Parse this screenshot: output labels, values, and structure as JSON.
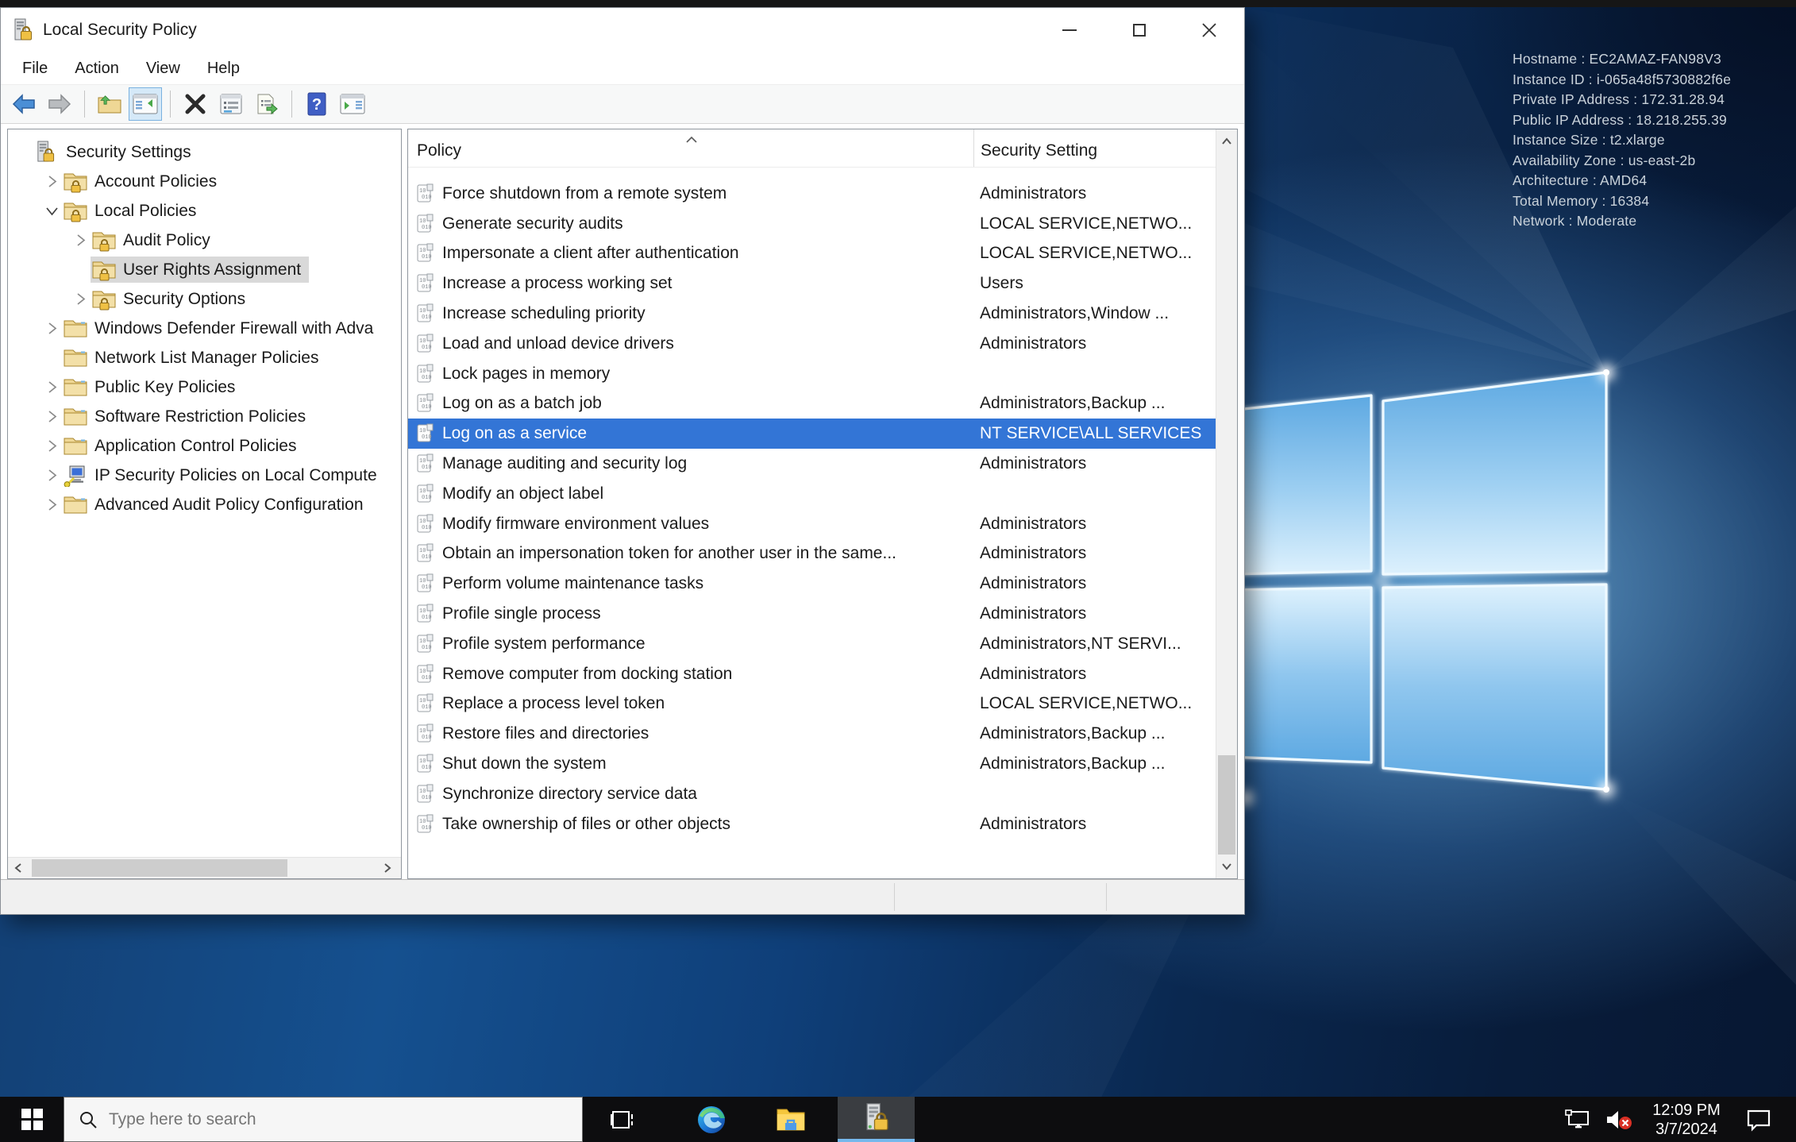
{
  "window": {
    "title": "Local Security Policy",
    "app_icon": "server-lock-icon",
    "menu": [
      "File",
      "Action",
      "View",
      "Help"
    ],
    "controls": [
      "minimize",
      "maximize",
      "close"
    ]
  },
  "toolbar": {
    "buttons": [
      "back",
      "forward",
      "up-one-level",
      "show-console-tree",
      "delete",
      "properties",
      "export-list",
      "help",
      "show-action-pane"
    ],
    "active_button": "show-console-tree"
  },
  "tree": {
    "items": [
      {
        "label": "Security Settings",
        "level": 0,
        "expander": "none",
        "icon": "computer-lock",
        "selected": false
      },
      {
        "label": "Account Policies",
        "level": 1,
        "expander": "collapsed",
        "icon": "folder-lock",
        "selected": false
      },
      {
        "label": "Local Policies",
        "level": 1,
        "expander": "expanded",
        "icon": "folder-lock",
        "selected": false
      },
      {
        "label": "Audit Policy",
        "level": 2,
        "expander": "collapsed",
        "icon": "folder-lock",
        "selected": false
      },
      {
        "label": "User Rights Assignment",
        "level": 2,
        "expander": "none",
        "icon": "folder-lock",
        "selected": true
      },
      {
        "label": "Security Options",
        "level": 2,
        "expander": "collapsed",
        "icon": "folder-lock",
        "selected": false
      },
      {
        "label": "Windows Defender Firewall with Adva",
        "level": 1,
        "expander": "collapsed",
        "icon": "folder",
        "selected": false
      },
      {
        "label": "Network List Manager Policies",
        "level": 1,
        "expander": "none",
        "icon": "folder",
        "selected": false
      },
      {
        "label": "Public Key Policies",
        "level": 1,
        "expander": "collapsed",
        "icon": "folder",
        "selected": false
      },
      {
        "label": "Software Restriction Policies",
        "level": 1,
        "expander": "collapsed",
        "icon": "folder",
        "selected": false
      },
      {
        "label": "Application Control Policies",
        "level": 1,
        "expander": "collapsed",
        "icon": "folder",
        "selected": false
      },
      {
        "label": "IP Security Policies on Local Compute",
        "level": 1,
        "expander": "collapsed",
        "icon": "ipsec",
        "selected": false
      },
      {
        "label": "Advanced Audit Policy Configuration",
        "level": 1,
        "expander": "collapsed",
        "icon": "folder",
        "selected": false
      }
    ]
  },
  "policy_list": {
    "columns": [
      "Policy",
      "Security Setting"
    ],
    "sort": "ascending",
    "rows": [
      {
        "policy": "Force shutdown from a remote system",
        "setting": "Administrators",
        "selected": false
      },
      {
        "policy": "Generate security audits",
        "setting": "LOCAL SERVICE,NETWO...",
        "selected": false
      },
      {
        "policy": "Impersonate a client after authentication",
        "setting": "LOCAL SERVICE,NETWO...",
        "selected": false
      },
      {
        "policy": "Increase a process working set",
        "setting": "Users",
        "selected": false
      },
      {
        "policy": "Increase scheduling priority",
        "setting": "Administrators,Window ...",
        "selected": false
      },
      {
        "policy": "Load and unload device drivers",
        "setting": "Administrators",
        "selected": false
      },
      {
        "policy": "Lock pages in memory",
        "setting": "",
        "selected": false
      },
      {
        "policy": "Log on as a batch job",
        "setting": "Administrators,Backup ...",
        "selected": false
      },
      {
        "policy": "Log on as a service",
        "setting": "NT SERVICE\\ALL SERVICES",
        "selected": true
      },
      {
        "policy": "Manage auditing and security log",
        "setting": "Administrators",
        "selected": false
      },
      {
        "policy": "Modify an object label",
        "setting": "",
        "selected": false
      },
      {
        "policy": "Modify firmware environment values",
        "setting": "Administrators",
        "selected": false
      },
      {
        "policy": "Obtain an impersonation token for another user in the same...",
        "setting": "Administrators",
        "selected": false
      },
      {
        "policy": "Perform volume maintenance tasks",
        "setting": "Administrators",
        "selected": false
      },
      {
        "policy": "Profile single process",
        "setting": "Administrators",
        "selected": false
      },
      {
        "policy": "Profile system performance",
        "setting": "Administrators,NT SERVI...",
        "selected": false
      },
      {
        "policy": "Remove computer from docking station",
        "setting": "Administrators",
        "selected": false
      },
      {
        "policy": "Replace a process level token",
        "setting": "LOCAL SERVICE,NETWO...",
        "selected": false
      },
      {
        "policy": "Restore files and directories",
        "setting": "Administrators,Backup ...",
        "selected": false
      },
      {
        "policy": "Shut down the system",
        "setting": "Administrators,Backup ...",
        "selected": false
      },
      {
        "policy": "Synchronize directory service data",
        "setting": "",
        "selected": false
      },
      {
        "policy": "Take ownership of files or other objects",
        "setting": "Administrators",
        "selected": false
      }
    ]
  },
  "desktop": {
    "info_lines": [
      "Hostname : EC2AMAZ-FAN98V3",
      "Instance ID : i-065a48f5730882f6e",
      "Private IP Address : 172.31.28.94",
      "Public IP Address : 18.218.255.39",
      "Instance Size : t2.xlarge",
      "Availability Zone : us-east-2b",
      "Architecture : AMD64",
      "Total Memory : 16384",
      "Network : Moderate"
    ]
  },
  "taskbar": {
    "search_placeholder": "Type here to search",
    "buttons": [
      "start",
      "search",
      "task-view",
      "edge",
      "file-explorer",
      "local-security-policy"
    ],
    "active_app": "local-security-policy",
    "tray_icons": [
      "network",
      "volume-muted",
      "clock",
      "action-center"
    ],
    "clock": {
      "time": "12:09 PM",
      "date": "3/7/2024"
    }
  },
  "colors": {
    "selection_blue": "#3375d6",
    "tree_selection_gray": "#d9d9d9",
    "taskbar_black": "#0d0d0f",
    "active_underline": "#76b9ed"
  }
}
